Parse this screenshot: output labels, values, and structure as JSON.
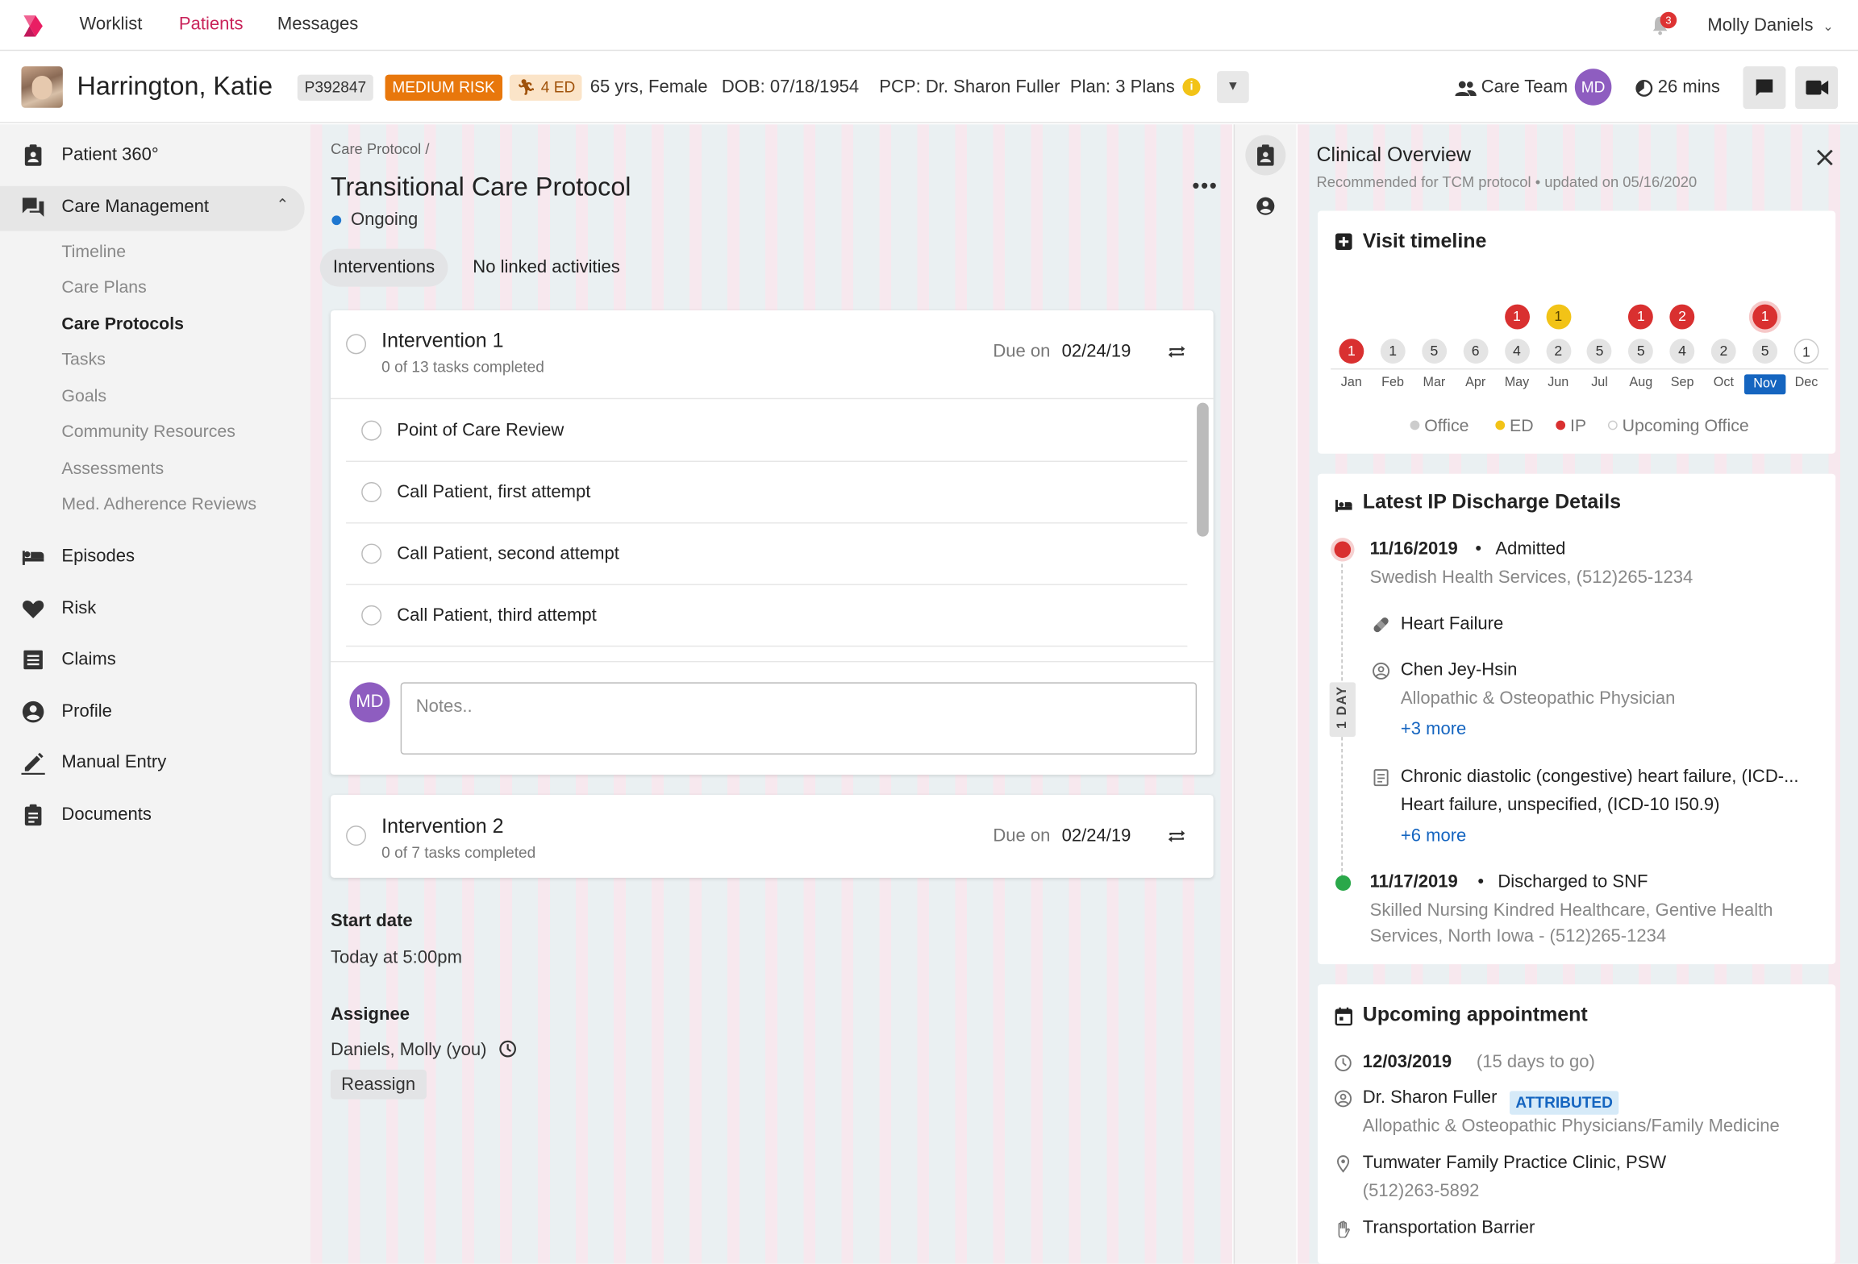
{
  "nav": {
    "links": [
      "Worklist",
      "Patients",
      "Messages"
    ],
    "notification_count": "3",
    "user_name": "Molly Daniels"
  },
  "patient": {
    "name": "Harrington, Katie",
    "id": "P392847",
    "risk": "MEDIUM RISK",
    "ed_count": "4 ED",
    "age_sex": "65 yrs, Female",
    "dob": "DOB: 07/18/1954",
    "pcp": "PCP: Dr. Sharon Fuller",
    "plan": "Plan: 3 Plans",
    "care_team_label": "Care Team",
    "care_team_initials": "MD",
    "timer": "26 mins"
  },
  "sidebar": {
    "items": [
      {
        "label": "Patient 360°",
        "icon": "clipboard-user-icon"
      },
      {
        "label": "Care Management",
        "icon": "forum-icon"
      },
      {
        "label": "Episodes",
        "icon": "bed-icon"
      },
      {
        "label": "Risk",
        "icon": "heart-icon"
      },
      {
        "label": "Claims",
        "icon": "list-icon"
      },
      {
        "label": "Profile",
        "icon": "account-circle-icon"
      },
      {
        "label": "Manual Entry",
        "icon": "pencil-icon"
      },
      {
        "label": "Documents",
        "icon": "clipboard-icon"
      }
    ],
    "sub_items": [
      "Timeline",
      "Care Plans",
      "Care Protocols",
      "Tasks",
      "Goals",
      "Community Resources",
      "Assessments",
      "Med. Adherence Reviews"
    ]
  },
  "protocol": {
    "breadcrumb": "Care Protocol /",
    "title": "Transitional Care Protocol",
    "status": "Ongoing",
    "tabs": [
      "Interventions",
      "No linked activities"
    ],
    "interventions": [
      {
        "title": "Intervention 1",
        "subtitle": "0 of 13 tasks completed",
        "due_label": "Due on",
        "due": "02/24/19"
      },
      {
        "title": "Intervention 2",
        "subtitle": "0 of 7 tasks completed",
        "due_label": "Due on",
        "due": "02/24/19"
      }
    ],
    "tasks": [
      "Point of Care Review",
      "Call Patient, first attempt",
      "Call Patient, second attempt",
      "Call Patient, third attempt"
    ],
    "notes_initials": "MD",
    "notes_placeholder": "Notes..",
    "start_date_label": "Start date",
    "start_date": "Today at 5:00pm",
    "assignee_label": "Assignee",
    "assignee": "Daniels, Molly (you)",
    "reassign": "Reassign"
  },
  "clinical": {
    "title": "Clinical Overview",
    "subtitle": "Recommended for TCM protocol • updated on 05/16/2020",
    "visit_timeline": {
      "title": "Visit timeline",
      "months": [
        "Jan",
        "Feb",
        "Mar",
        "Apr",
        "May",
        "Jun",
        "Jul",
        "Aug",
        "Sep",
        "Oct",
        "Nov",
        "Dec"
      ],
      "selected_month": "Nov",
      "office_counts": [
        "1",
        "1",
        "5",
        "6",
        "4",
        "2",
        "5",
        "5",
        "4",
        "2",
        "5",
        "1"
      ],
      "office_kind": [
        "ip",
        "office",
        "office",
        "office",
        "office",
        "office",
        "office",
        "office",
        "office",
        "office",
        "office",
        "upcoming"
      ],
      "upper_counts": [
        "",
        "",
        "",
        "",
        "1",
        "1",
        "",
        "1",
        "2",
        "",
        "1",
        ""
      ],
      "upper_kind": [
        "",
        "",
        "",
        "",
        "ip",
        "ed",
        "",
        "ip",
        "ip",
        "",
        "ip",
        ""
      ],
      "legend": [
        "Office",
        "ED",
        "IP",
        "Upcoming Office"
      ],
      "colors": {
        "office": "#e4e4e4",
        "ed": "#f2c317",
        "ip": "#d93030",
        "upcoming": "#ffffff",
        "selected": "#1565c0"
      }
    },
    "discharge": {
      "title": "Latest IP Discharge Details",
      "admit_date": "11/16/2019",
      "admit_status": "Admitted",
      "admit_facility": "Swedish Health Services, (512)265-1234",
      "condition": "Heart Failure",
      "physician": "Chen Jey-Hsin",
      "physician_type": "Allopathic & Osteopathic Physician",
      "physician_more": "+3 more",
      "diagnosis_1": "Chronic diastolic (congestive) heart failure, (ICD-...",
      "diagnosis_2": "Heart failure, unspecified, (ICD-10 I50.9)",
      "diagnosis_more": "+6 more",
      "duration": "1 DAY",
      "discharge_date": "11/17/2019",
      "discharge_status": "Discharged to SNF",
      "discharge_facility_1": "Skilled Nursing Kindred Healthcare, Gentive Health",
      "discharge_facility_2": "Services, North Iowa - (512)265-1234"
    },
    "appointment": {
      "title": "Upcoming appointment",
      "date": "12/03/2019",
      "days_to_go": "(15 days to go)",
      "doctor": "Dr. Sharon Fuller",
      "badge": "ATTRIBUTED",
      "specialty": "Allopathic & Osteopathic Physicians/Family Medicine",
      "clinic": "Tumwater Family Practice Clinic, PSW",
      "phone": "(512)263-5892",
      "barrier": "Transportation Barrier"
    }
  }
}
